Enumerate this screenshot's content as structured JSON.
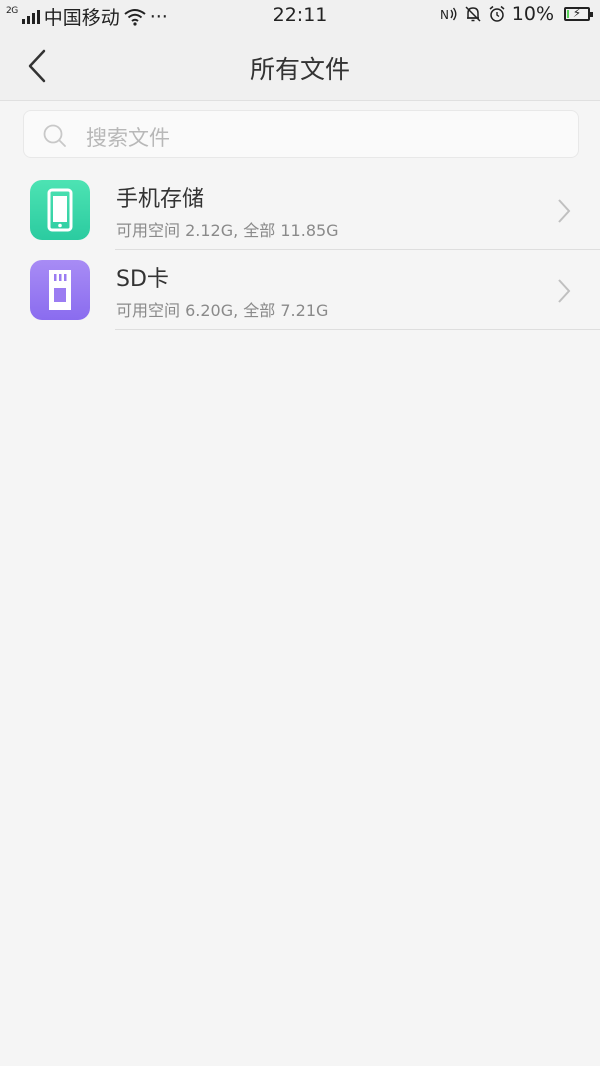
{
  "status_bar": {
    "network_type": "2G",
    "carrier": "中国移动",
    "more": "···",
    "time": "22:11",
    "battery_percent": "10%",
    "battery_level": 0.1
  },
  "header": {
    "title": "所有文件",
    "back_icon": "chevron-left-icon"
  },
  "search": {
    "placeholder": "搜索文件",
    "icon": "search-icon"
  },
  "storage_items": [
    {
      "name": "手机存储",
      "detail": "可用空间 2.12G, 全部 11.85G",
      "icon": "phone-icon",
      "color": "#3dd6a7"
    },
    {
      "name": "SD卡",
      "detail": "可用空间 6.20G, 全部 7.21G",
      "icon": "sd-card-icon",
      "color": "#9b7cf2"
    }
  ],
  "colors": {
    "background": "#f5f5f5",
    "header_bg": "#f0f0f0",
    "phone_gradient_top": "#4de3b3",
    "phone_gradient_bottom": "#2bcba0",
    "sd_gradient_top": "#a88cf5",
    "sd_gradient_bottom": "#8a6cef"
  }
}
